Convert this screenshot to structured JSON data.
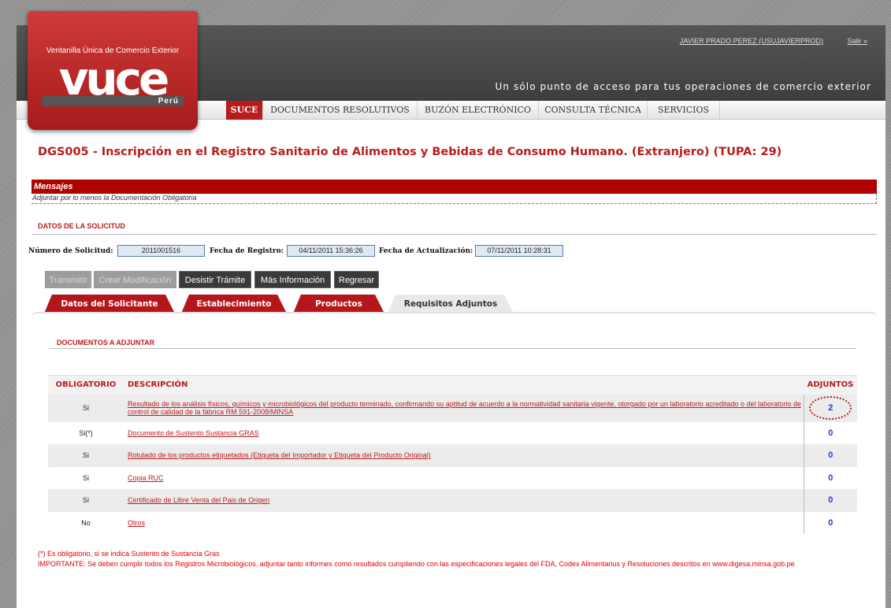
{
  "header": {
    "user": "JAVIER PRADO PEREZ (USUJAVIERPROD)",
    "logout": "Salir »",
    "slogan": "Un sólo punto de acceso para tus operaciones de comercio exterior"
  },
  "logo": {
    "tagline": "Ventanilla Única de Comercio Exterior",
    "word": "vuce",
    "country": "Perú"
  },
  "nav": {
    "items": [
      "SUCE",
      "DOCUMENTOS RESOLUTIVOS",
      "BUZÓN ELECTRÓNICO",
      "CONSULTA TÉCNICA",
      "SERVICIOS"
    ],
    "active": "SUCE"
  },
  "page_title": "DGS005 - Inscripción en el Registro Sanitario de Alimentos y Bebidas de Consumo Humano. (Extranjero) (TUPA: 29)",
  "messages": {
    "title": "Mensajes",
    "text": "Adjuntar por lo menos la Documentación Obligatoria"
  },
  "solicitud": {
    "section_title": "DATOS DE LA SOLICITUD",
    "numero_label": "Número de Solicitud:",
    "numero_value": "2011001516",
    "fecha_registro_label": "Fecha de Registro:",
    "fecha_registro_value": "04/11/2011 15:36:26",
    "fecha_actualizacion_label": "Fecha de Actualización:",
    "fecha_actualizacion_value": "07/11/2011 10:28:31"
  },
  "buttons": {
    "transmitir": "Transmitir",
    "crear_modificacion": "Crear Modificación",
    "desistir": "Desistir Trámite",
    "mas_info": "Más Información",
    "regresar": "Regresar"
  },
  "tabs": {
    "solicitante": "Datos del Solicitante",
    "establecimiento": "Establecimiento",
    "productos": "Productos",
    "requisitos": "Requisitos Adjuntos"
  },
  "docs": {
    "section_title": "DOCUMENTOS A ADJUNTAR",
    "headers": {
      "obligatorio": "OBLIGATORIO",
      "descripcion": "DESCRIPCIÓN",
      "adjuntos": "ADJUNTOS"
    },
    "rows": [
      {
        "obligatorio": "Si",
        "descripcion": "Resultado de los análisis físicos, químicos y microbiológicos del producto terminado, confirmando su aptitud de acuerdo a la normatividad sanitaria vigente, otorgado por un laboratorio acreditado o del laboratorio de control de calidad de la fábrica RM 591-2008/MINSA",
        "adjuntos": "2"
      },
      {
        "obligatorio": "Si(*)",
        "descripcion": "Documento de Sustento Sustancia GRAS",
        "adjuntos": "0"
      },
      {
        "obligatorio": "Si",
        "descripcion": "Rotulado de los productos etiquetados (Etiqueta del Importador y Etiqueta del Producto Original)",
        "adjuntos": "0"
      },
      {
        "obligatorio": "Si",
        "descripcion": "Copia RUC",
        "adjuntos": "0"
      },
      {
        "obligatorio": "Si",
        "descripcion": "Certificado de Libre Venta del Pais de Origen",
        "adjuntos": "0"
      },
      {
        "obligatorio": "No",
        "descripcion": "Otros",
        "adjuntos": "0"
      }
    ]
  },
  "notes": {
    "note1": "(*) Es obligatorio, si se indica Sustento de Sustancia Gras",
    "note2": "IMPORTANTE: Se deben cumplir todos los Registros Microbiológicos, adjuntar tanto informes como resultados cumpliendo con las especificaciones legales del FDA, Codex Alimentarius y Resoluciones descritos en www.digesa.minsa.gob.pe"
  },
  "colors": {
    "brand_red": "#b81c1c",
    "header_dark": "#4b4b4b",
    "link_blue": "#1d3fd6"
  }
}
